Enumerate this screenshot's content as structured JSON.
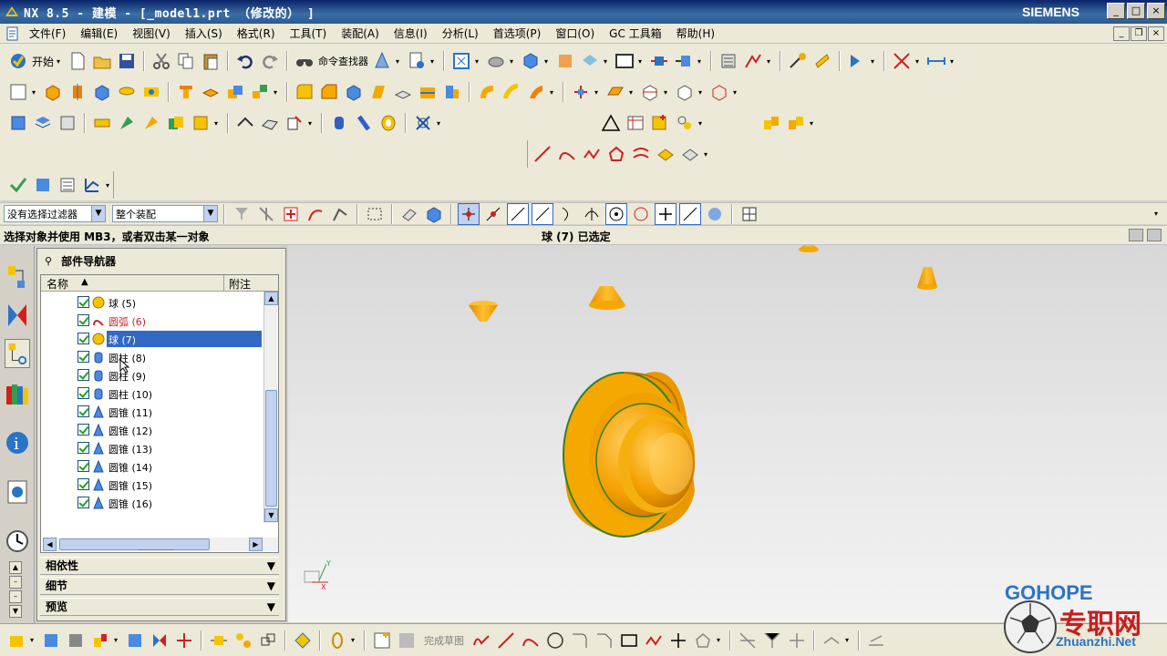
{
  "window": {
    "title": "NX 8.5 - 建模 - [_model1.prt （修改的） ]",
    "brand": "SIEMENS",
    "min": "_",
    "max": "□",
    "close": "×"
  },
  "menu": [
    "文件(F)",
    "编辑(E)",
    "视图(V)",
    "插入(S)",
    "格式(R)",
    "工具(T)",
    "装配(A)",
    "信息(I)",
    "分析(L)",
    "首选项(P)",
    "窗口(O)",
    "GC 工具箱",
    "帮助(H)"
  ],
  "toolbar": {
    "start_label": "开始",
    "cmd_finder": "命令查找器"
  },
  "filter": {
    "type_filter": "没有选择过滤器",
    "scope": "整个装配"
  },
  "status": {
    "prompt": "选择对象并使用 MB3，或者双击某一对象",
    "selection": "球 (7) 已选定"
  },
  "navigator": {
    "title": "部件导航器",
    "col_name": "名称",
    "col_note": "附注",
    "rows": [
      {
        "label": "球 (5)",
        "icon": "sphere-icon"
      },
      {
        "label": "圆弧 (6)",
        "icon": "arc-icon"
      },
      {
        "label": "球 (7)",
        "icon": "sphere-icon"
      },
      {
        "label": "圆柱 (8)",
        "icon": "cylinder-icon"
      },
      {
        "label": "圆柱 (9)",
        "icon": "cylinder-icon"
      },
      {
        "label": "圆柱 (10)",
        "icon": "cylinder-icon"
      },
      {
        "label": "圆锥 (11)",
        "icon": "cone-icon"
      },
      {
        "label": "圆锥 (12)",
        "icon": "cone-icon"
      },
      {
        "label": "圆锥 (13)",
        "icon": "cone-icon"
      },
      {
        "label": "圆锥 (14)",
        "icon": "cone-icon"
      },
      {
        "label": "圆锥 (15)",
        "icon": "cone-icon"
      },
      {
        "label": "圆锥 (16)",
        "icon": "cone-icon"
      }
    ],
    "sections": [
      "相依性",
      "细节",
      "预览"
    ]
  },
  "bottom": {
    "finish_sketch": "完成草图"
  },
  "watermark": {
    "brand": "GOHOPE",
    "cn": "专职网",
    "url": "Zhuanzhi.Net"
  },
  "colors": {
    "model": "#f5a800",
    "selection": "#316ac5",
    "title_bar": "#0a246a"
  }
}
